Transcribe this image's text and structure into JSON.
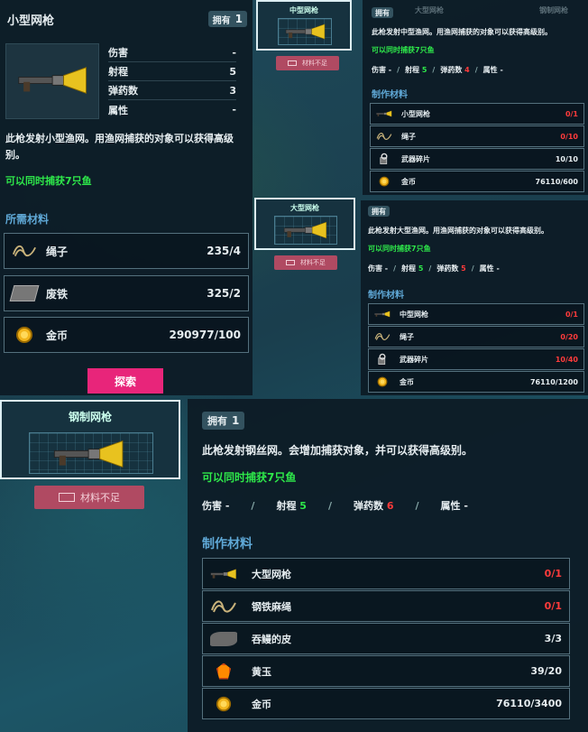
{
  "small_gun": {
    "title": "小型网枪",
    "owned_label": "拥有",
    "owned_count": "1",
    "stats": [
      {
        "label": "伤害",
        "value": "-"
      },
      {
        "label": "射程",
        "value": "5"
      },
      {
        "label": "弹药数",
        "value": "3"
      },
      {
        "label": "属性",
        "value": "-"
      }
    ],
    "desc": "此枪发射小型渔网。用渔网捕获的对象可以获得高级别。",
    "catch": "可以同时捕获7只鱼",
    "materials_title": "所需材料",
    "materials": [
      {
        "icon": "rope-icon",
        "name": "绳子",
        "count": "235/4"
      },
      {
        "icon": "scrap-iron-icon",
        "name": "废铁",
        "count": "325/2"
      },
      {
        "icon": "gold-coin-icon",
        "name": "金币",
        "count": "290977/100"
      }
    ],
    "explore_button": "探索"
  },
  "medium_gun": {
    "card_title": "中型网枪",
    "insufficient": "材料不足",
    "tabs": [
      "大型网枪",
      "钢制网枪"
    ],
    "owned_label": "拥有",
    "desc": "此枪发射中型渔网。用渔网捕获的对象可以获得高级别。",
    "catch": "可以同时捕获7只鱼",
    "stats": [
      {
        "label": "伤害",
        "value": "-"
      },
      {
        "label": "射程",
        "value": "5"
      },
      {
        "label": "弹药数",
        "value": "4"
      },
      {
        "label": "属性",
        "value": "-"
      }
    ],
    "materials_title": "制作材料",
    "materials": [
      {
        "icon": "small-net-gun-icon",
        "name": "小型网枪",
        "count": "0/1",
        "status": "short"
      },
      {
        "icon": "rope-icon",
        "name": "绳子",
        "count": "0/10",
        "status": "short"
      },
      {
        "icon": "weapon-fragment-icon",
        "name": "武器碎片",
        "count": "10/10",
        "status": "ok"
      },
      {
        "icon": "gold-coin-icon",
        "name": "金币",
        "count": "76110/600",
        "status": "ok"
      }
    ]
  },
  "large_gun": {
    "card_title": "大型网枪",
    "insufficient": "材料不足",
    "owned_label": "拥有",
    "desc": "此枪发射大型渔网。用渔网捕获的对象可以获得高级别。",
    "catch": "可以同时捕获7只鱼",
    "stats": [
      {
        "label": "伤害",
        "value": "-"
      },
      {
        "label": "射程",
        "value": "5"
      },
      {
        "label": "弹药数",
        "value": "5"
      },
      {
        "label": "属性",
        "value": "-"
      }
    ],
    "materials_title": "制作材料",
    "materials": [
      {
        "icon": "medium-net-gun-icon",
        "name": "中型网枪",
        "count": "0/1",
        "status": "short"
      },
      {
        "icon": "rope-icon",
        "name": "绳子",
        "count": "0/20",
        "status": "short"
      },
      {
        "icon": "weapon-fragment-icon",
        "name": "武器碎片",
        "count": "10/40",
        "status": "short"
      },
      {
        "icon": "gold-coin-icon",
        "name": "金币",
        "count": "76110/1200",
        "status": "ok"
      }
    ]
  },
  "steel_gun": {
    "card_title": "钢制网枪",
    "insufficient": "材料不足",
    "owned_label": "拥有",
    "owned_count": "1",
    "desc": "此枪发射钢丝网。会增加捕获对象，并可以获得高级别。",
    "catch": "可以同时捕获7只鱼",
    "stats": [
      {
        "label": "伤害",
        "value": "-"
      },
      {
        "label": "射程",
        "value": "5"
      },
      {
        "label": "弹药数",
        "value": "6"
      },
      {
        "label": "属性",
        "value": "-"
      }
    ],
    "materials_title": "制作材料",
    "materials": [
      {
        "icon": "large-net-gun-icon",
        "name": "大型网枪",
        "count": "0/1",
        "status": "short"
      },
      {
        "icon": "steel-hemp-rope-icon",
        "name": "钢铁麻绳",
        "count": "0/1",
        "status": "short"
      },
      {
        "icon": "eel-skin-icon",
        "name": "吞鳗的皮",
        "count": "3/3",
        "status": "ok"
      },
      {
        "icon": "topaz-icon",
        "name": "黄玉",
        "count": "39/20",
        "status": "ok"
      },
      {
        "icon": "gold-coin-icon",
        "name": "金币",
        "count": "76110/3400",
        "status": "ok"
      }
    ]
  },
  "colors": {
    "accent_green": "#2ee84a",
    "short_red": "#ff3b3b",
    "section_blue": "#5fa8d6",
    "explore_pink": "#e8257a"
  }
}
